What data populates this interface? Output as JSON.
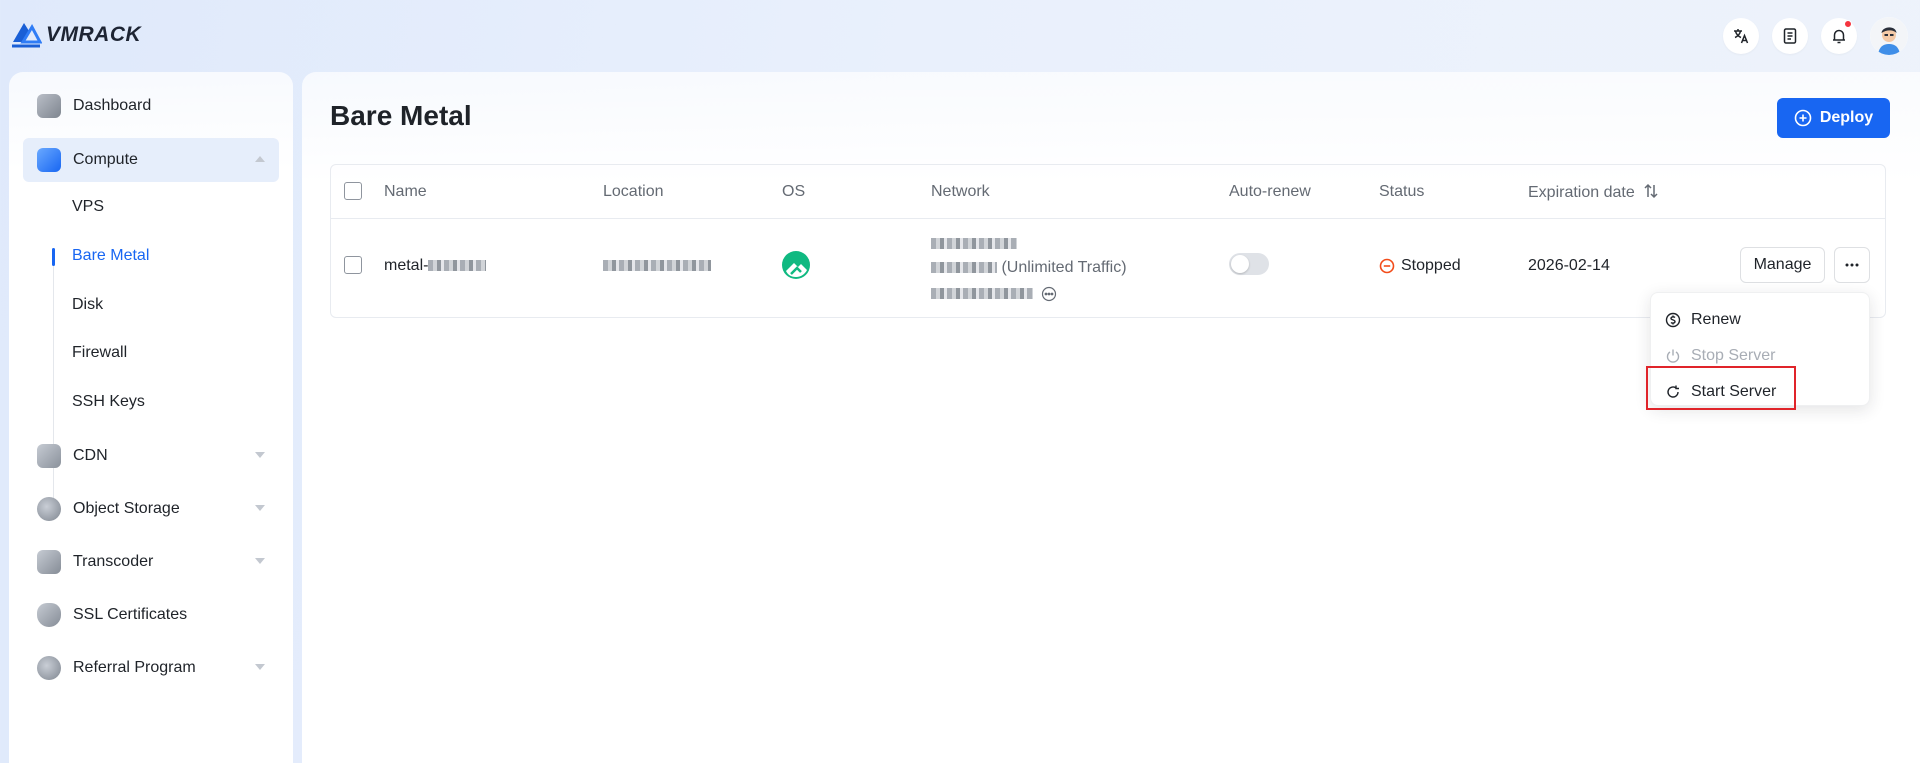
{
  "app": {
    "logo_text": "VMRACK"
  },
  "header": {
    "icons": [
      "translate-icon",
      "document-icon",
      "bell-icon",
      "avatar"
    ]
  },
  "sidebar": {
    "items": [
      {
        "label": "Dashboard",
        "icon": "dashboard-icon"
      },
      {
        "label": "Compute",
        "icon": "compute-icon",
        "expanded": true
      },
      {
        "label": "CDN",
        "icon": "cdn-icon"
      },
      {
        "label": "Object Storage",
        "icon": "object-storage-icon"
      },
      {
        "label": "Transcoder",
        "icon": "transcoder-icon"
      },
      {
        "label": "SSL Certificates",
        "icon": "ssl-icon"
      },
      {
        "label": "Referral Program",
        "icon": "referral-icon"
      }
    ],
    "compute_sub": [
      {
        "label": "VPS"
      },
      {
        "label": "Bare Metal",
        "active": true
      },
      {
        "label": "Disk"
      },
      {
        "label": "Firewall"
      },
      {
        "label": "SSH Keys"
      }
    ]
  },
  "main": {
    "title": "Bare Metal",
    "deploy_label": "Deploy",
    "table": {
      "columns": [
        "Name",
        "Location",
        "OS",
        "Network",
        "Auto-renew",
        "Status",
        "Expiration date"
      ],
      "rows": [
        {
          "name_prefix": "metal-",
          "network_traffic": "(Unlimited Traffic)",
          "auto_renew": false,
          "status": "Stopped",
          "expiration": "2026-02-14",
          "manage_label": "Manage"
        }
      ]
    }
  },
  "menu": {
    "items": [
      {
        "label": "Renew",
        "icon": "renew-icon",
        "disabled": false
      },
      {
        "label": "Stop Server",
        "icon": "power-icon",
        "disabled": true
      },
      {
        "label": "Start Server",
        "icon": "restart-icon",
        "disabled": false
      }
    ]
  },
  "colors": {
    "accent": "#1866f2",
    "stopped": "#f24c1a",
    "os_logo": "#10b981",
    "highlight": "#e0242a"
  }
}
